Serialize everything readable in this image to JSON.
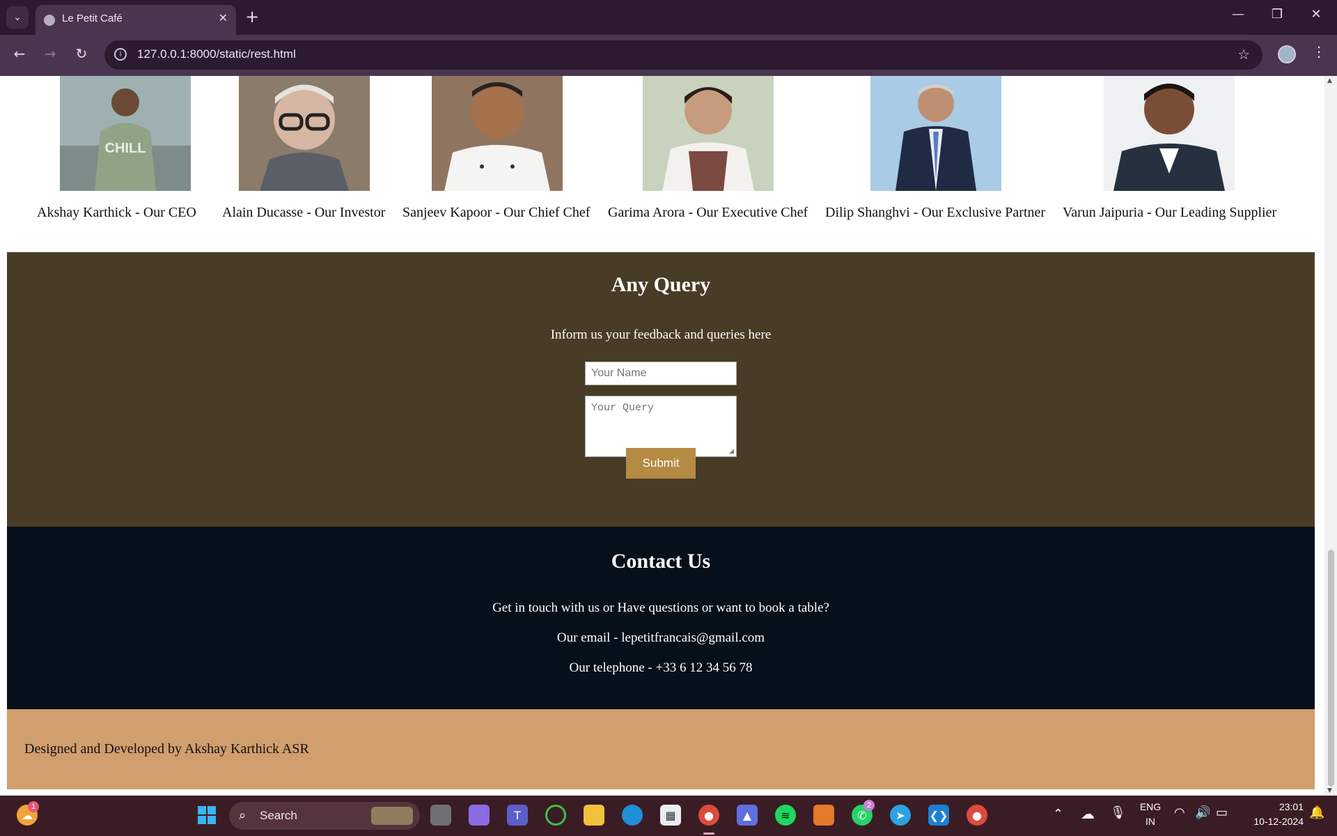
{
  "browser": {
    "tab_title": "Le Petit Café",
    "url": "127.0.0.1:8000/static/rest.html",
    "tab_list_icon": "chevron-down-icon",
    "close_tab_glyph": "✕",
    "new_tab_glyph": "+",
    "minimize_glyph": "—",
    "restore_glyph": "❐",
    "close_window_glyph": "✕",
    "back_glyph": "←",
    "forward_glyph": "→",
    "reload_glyph": "↻",
    "star_glyph": "☆",
    "menu_glyph": "⋮",
    "site_info_glyph": "i"
  },
  "team": [
    {
      "caption": "Akshay Karthick - Our CEO",
      "photo_color": "#7f8e8a"
    },
    {
      "caption": "Alain Ducasse - Our Investor",
      "photo_color": "#8a7c6e"
    },
    {
      "caption": "Sanjeev Kapoor - Our Chief Chef",
      "photo_color": "#9a8066"
    },
    {
      "caption": "Garima Arora - Our Executive Chef",
      "photo_color": "#b7c3a8"
    },
    {
      "caption": "Dilip Shanghvi - Our Exclusive Partner",
      "photo_color": "#8fb4d4"
    },
    {
      "caption": "Varun Jaipuria - Our Leading Supplier",
      "photo_color": "#3e4a5a"
    }
  ],
  "query_section": {
    "heading": "Any Query",
    "subtext": "Inform us your feedback and queries here",
    "name_placeholder": "Your Name",
    "query_placeholder": "Your Query",
    "submit_label": "Submit"
  },
  "contact": {
    "heading": "Contact Us",
    "line1": "Get in touch with us or Have questions or want to book a table?",
    "email_line": "Our email - lepetitfrancais@gmail.com",
    "phone_line": "Our telephone - +33 6 12 34 56 78"
  },
  "footer": {
    "credit": "Designed and Developed by Akshay Karthick ASR"
  },
  "taskbar": {
    "search_label": "Search",
    "weather_badge": "1",
    "whatsapp_badge": "2",
    "language_top": "ENG",
    "language_bottom": "IN",
    "time": "23:01",
    "date": "10-12-2024"
  },
  "colors": {
    "query_bg": "#483c27",
    "contact_bg": "#06101a",
    "footer_bg": "#d19e6d",
    "submit_bg": "#b58a43"
  }
}
